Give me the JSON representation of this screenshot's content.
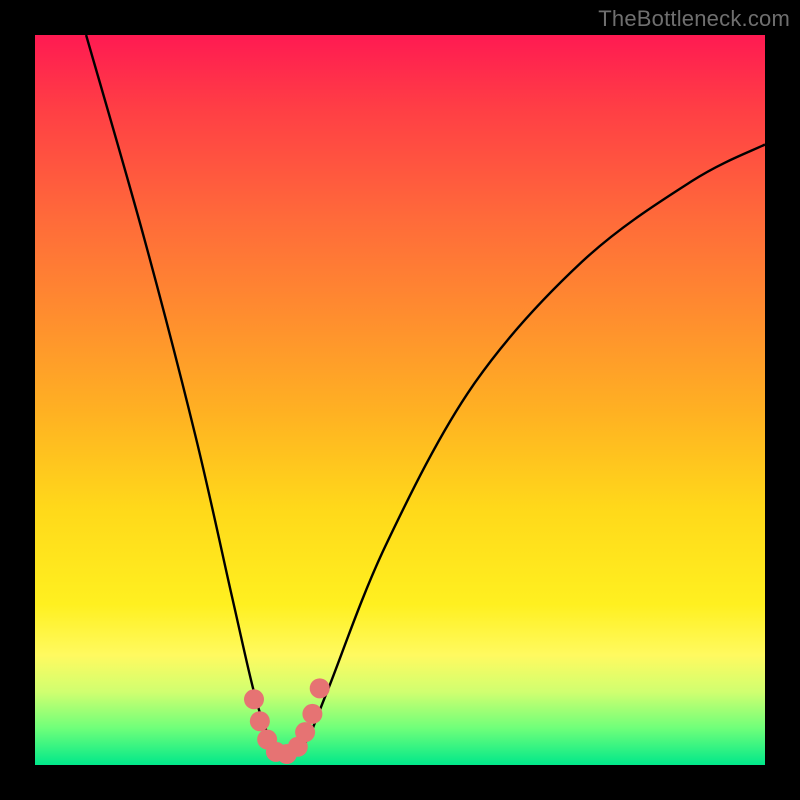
{
  "watermark": "TheBottleneck.com",
  "colors": {
    "frame": "#000000",
    "curve_stroke": "#000000",
    "marker_fill": "#e67373",
    "gradient_top": "#ff1a52",
    "gradient_bottom": "#00e88a"
  },
  "chart_data": {
    "type": "line",
    "title": "",
    "xlabel": "",
    "ylabel": "",
    "xlim": [
      0,
      100
    ],
    "ylim": [
      0,
      100
    ],
    "note": "No axis ticks or numeric labels are visible; values are approximate positions in 0–100 plot-area percent, where y=0 is bottom and y=100 is top.",
    "series": [
      {
        "name": "bottleneck-curve-left",
        "points": [
          {
            "x": 7,
            "y": 100
          },
          {
            "x": 15,
            "y": 72
          },
          {
            "x": 22,
            "y": 45
          },
          {
            "x": 27,
            "y": 23
          },
          {
            "x": 30,
            "y": 10
          },
          {
            "x": 32,
            "y": 4
          },
          {
            "x": 34,
            "y": 1
          }
        ]
      },
      {
        "name": "bottleneck-curve-right",
        "points": [
          {
            "x": 34,
            "y": 1
          },
          {
            "x": 37,
            "y": 3
          },
          {
            "x": 40,
            "y": 10
          },
          {
            "x": 48,
            "y": 30
          },
          {
            "x": 60,
            "y": 52
          },
          {
            "x": 75,
            "y": 69
          },
          {
            "x": 90,
            "y": 80
          },
          {
            "x": 100,
            "y": 85
          }
        ]
      }
    ],
    "markers": [
      {
        "x": 30.0,
        "y": 9.0
      },
      {
        "x": 30.8,
        "y": 6.0
      },
      {
        "x": 31.8,
        "y": 3.5
      },
      {
        "x": 33.0,
        "y": 1.8
      },
      {
        "x": 34.5,
        "y": 1.5
      },
      {
        "x": 36.0,
        "y": 2.5
      },
      {
        "x": 37.0,
        "y": 4.5
      },
      {
        "x": 38.0,
        "y": 7.0
      },
      {
        "x": 39.0,
        "y": 10.5
      }
    ]
  }
}
